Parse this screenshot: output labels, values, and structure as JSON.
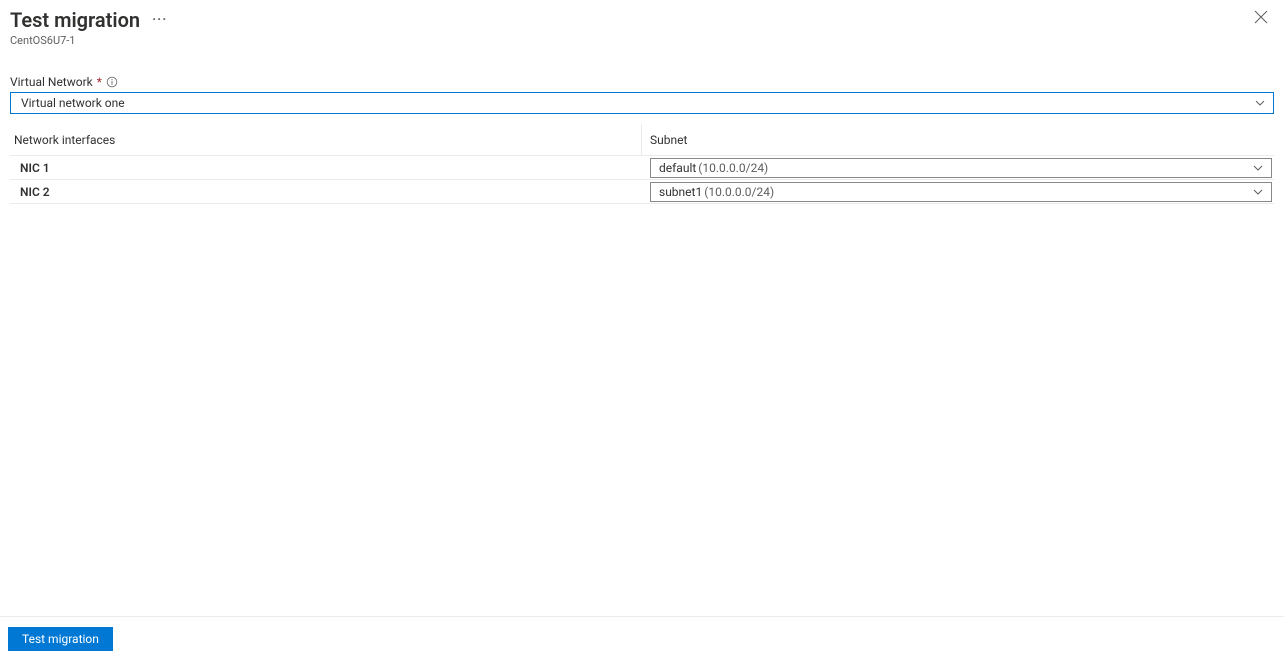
{
  "header": {
    "title": "Test migration",
    "subtitle": "CentOS6U7-1"
  },
  "virtualNetwork": {
    "label": "Virtual Network",
    "selected": "Virtual network one"
  },
  "table": {
    "columns": {
      "interfaces": "Network interfaces",
      "subnet": "Subnet"
    },
    "rows": [
      {
        "nic": "NIC 1",
        "subnetName": "default",
        "subnetCidr": "(10.0.0.0/24)"
      },
      {
        "nic": "NIC 2",
        "subnetName": "subnet1",
        "subnetCidr": "(10.0.0.0/24)"
      }
    ]
  },
  "footer": {
    "primaryButton": "Test migration"
  }
}
